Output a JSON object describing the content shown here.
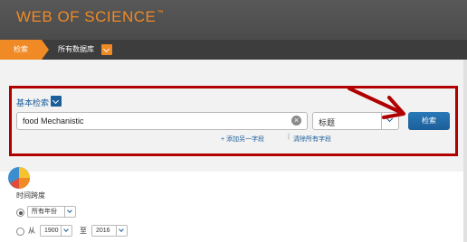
{
  "header": {
    "logo": "WEB OF SCIENCE",
    "trademark": "™"
  },
  "nav": {
    "active_tab": "检索",
    "database": "所有数据库"
  },
  "search": {
    "mode_label": "基本检索",
    "query": "food Mechanistic",
    "field": "标题",
    "button": "检索",
    "add_field": "+ 添加另一字段",
    "separator": "|",
    "reset_fields": "清除所有字段"
  },
  "timespan": {
    "label": "时间跨度",
    "all_years": "所有年份",
    "from_label": "从",
    "from_year": "1900",
    "to_label": "至",
    "to_year": "2016"
  },
  "colors": {
    "brand": "#f08a24",
    "header": "#4b4b4b",
    "accent": "#1a5e9a",
    "annotation": "#b00000"
  }
}
